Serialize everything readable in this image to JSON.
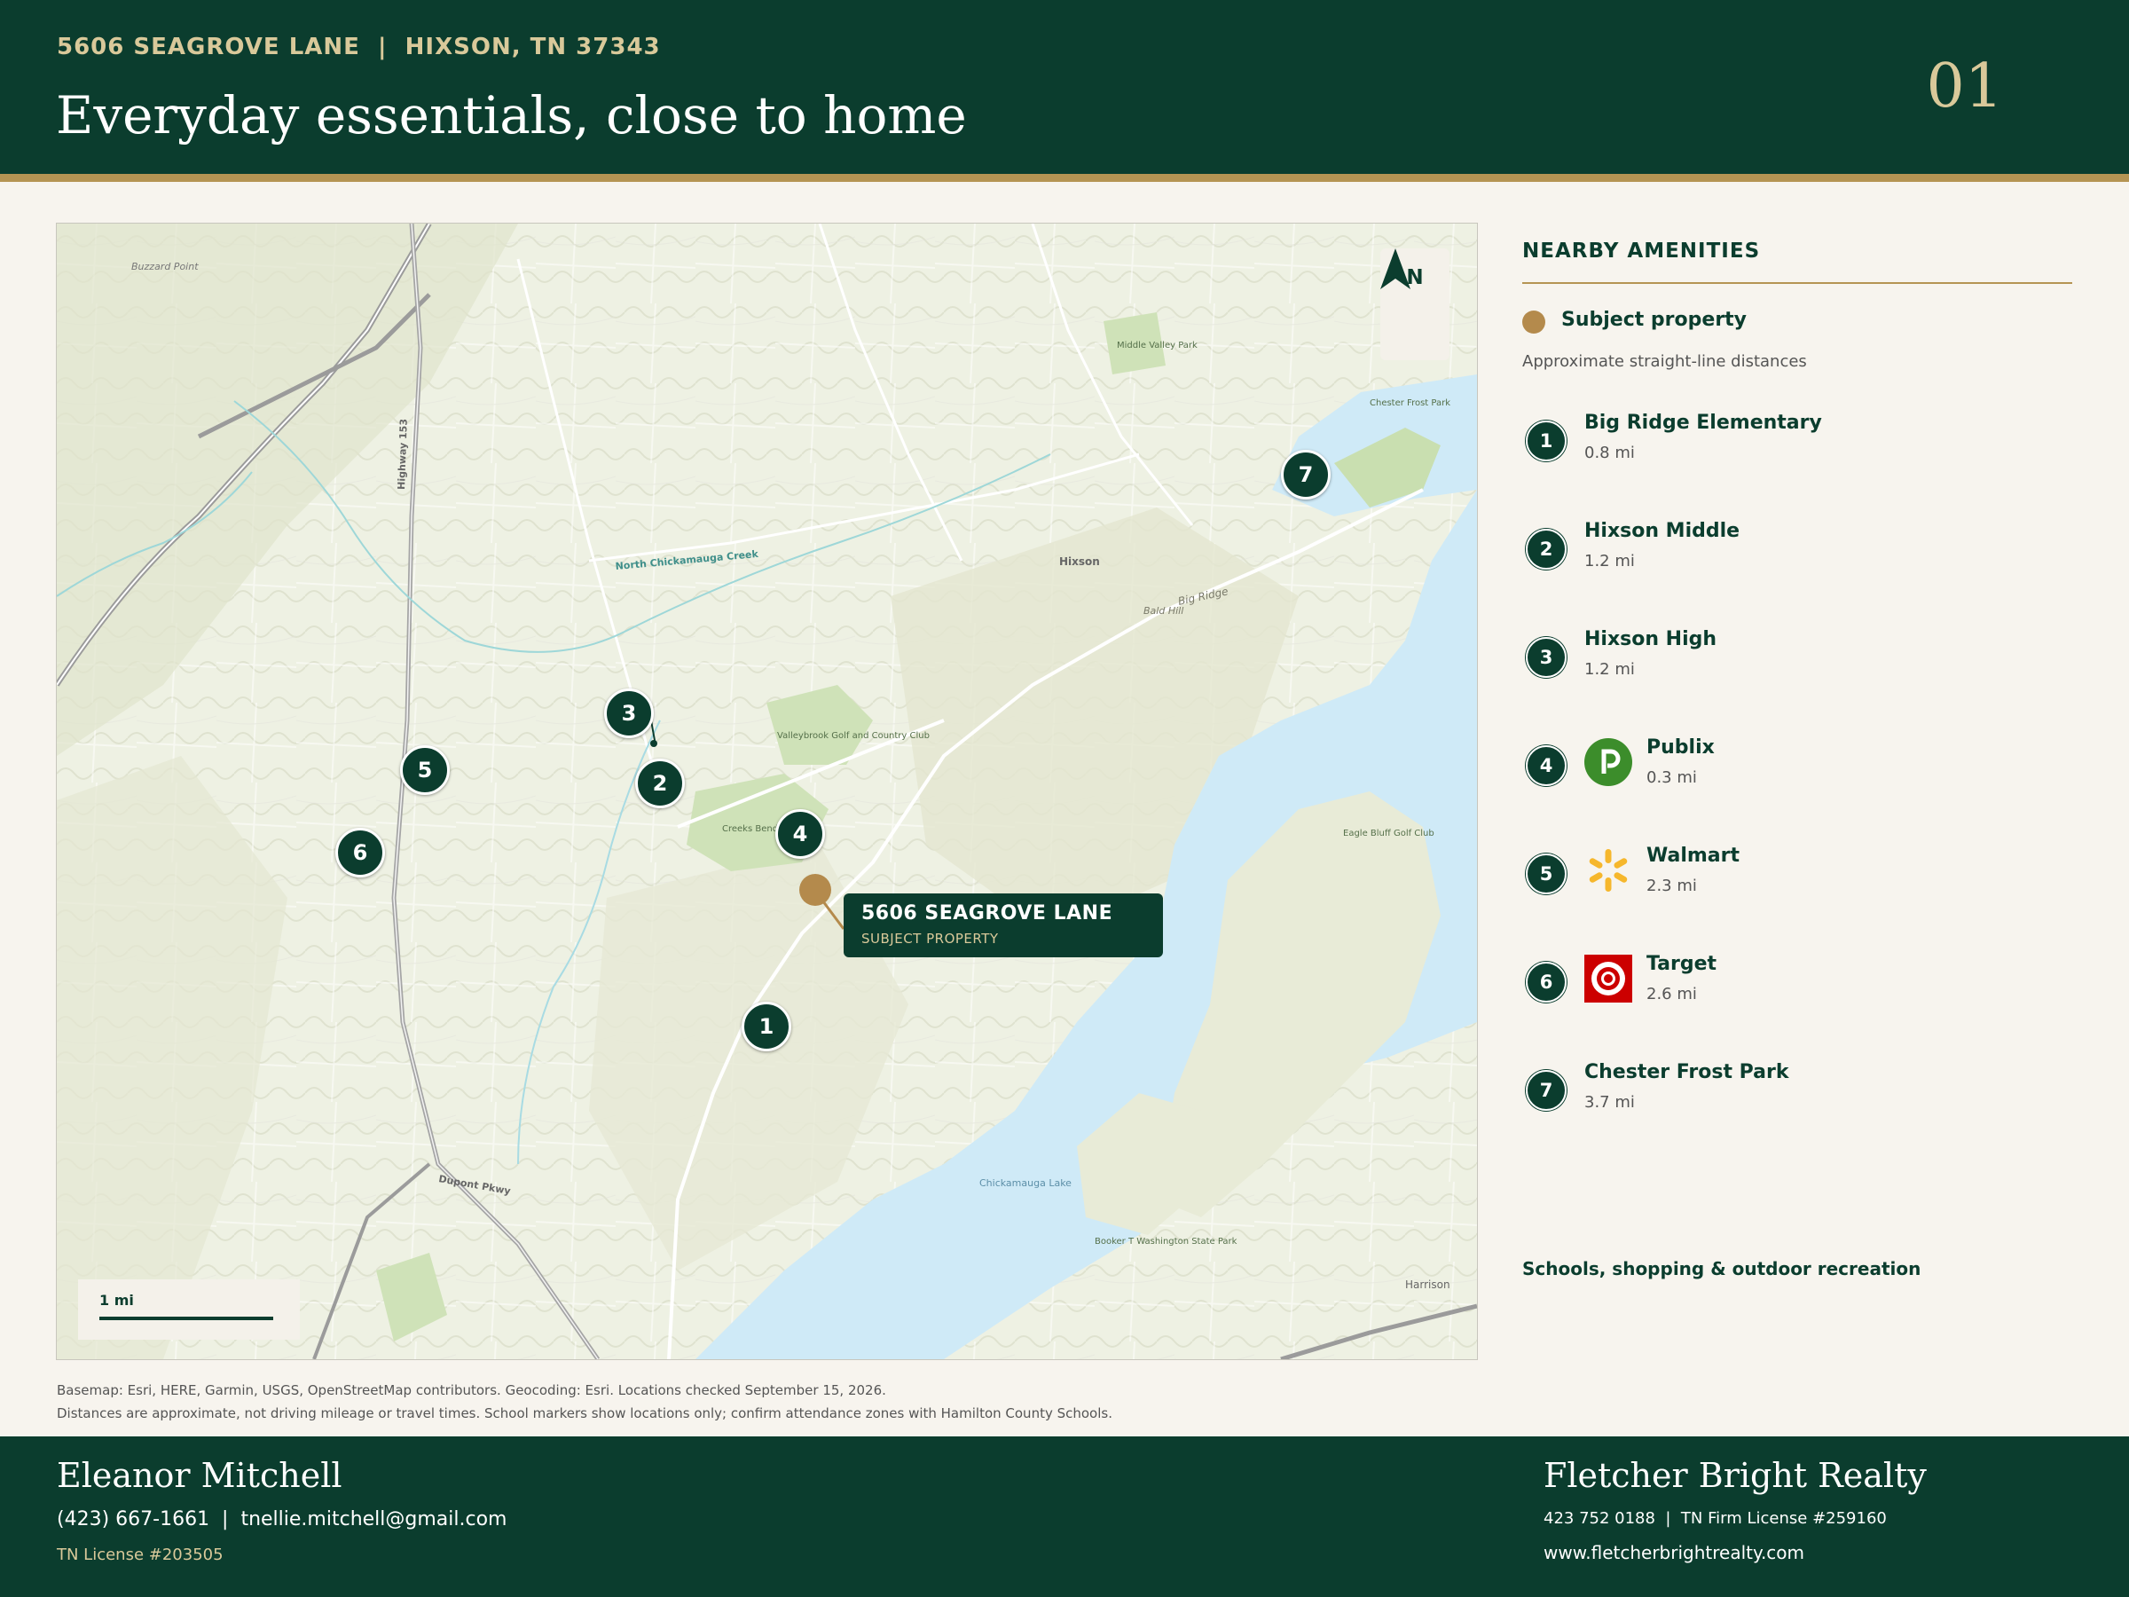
{
  "header": {
    "address": "5606 SEAGROVE LANE  |  HIXSON, TN 37343",
    "title": "Everyday essentials, close to home",
    "page_number": "01"
  },
  "map": {
    "north_label": "N",
    "scale_label": "1 mi",
    "subject": {
      "title": "5606 SEAGROVE LANE",
      "subtitle": "SUBJECT PROPERTY"
    },
    "markers": [
      "1",
      "2",
      "3",
      "4",
      "5",
      "6",
      "7"
    ],
    "basemap_labels": {
      "hixson": "Hixson",
      "big_ridge": "Big Ridge",
      "lake": "Chickamauga Lake",
      "harrison": "Harrison",
      "creek": "North Chickamauga Creek",
      "golf": "Creeks Bend Golf Club",
      "valleybrook": "Valleybrook Golf and Country Club",
      "chester_frost": "Chester Frost Park",
      "buzzard": "Buzzard Point",
      "bald_hill": "Bald Hill",
      "dupont": "Dupont Pkwy",
      "hwy153": "Highway 153",
      "eagle_bluff": "Eagle Bluff Golf Club",
      "booker": "Booker T Washington State Park",
      "middle_valley": "Middle Valley Park"
    }
  },
  "sidebar": {
    "heading": "NEARBY AMENITIES",
    "legend_label": "Subject property",
    "note": "Approximate straight-line distances",
    "items": [
      {
        "num": "1",
        "name": "Big Ridge Elementary",
        "distance": "0.8 mi",
        "logo": ""
      },
      {
        "num": "2",
        "name": "Hixson Middle",
        "distance": "1.2 mi",
        "logo": ""
      },
      {
        "num": "3",
        "name": "Hixson High",
        "distance": "1.2 mi",
        "logo": ""
      },
      {
        "num": "4",
        "name": "Publix",
        "distance": "0.3 mi",
        "logo": "publix-logo"
      },
      {
        "num": "5",
        "name": "Walmart",
        "distance": "2.3 mi",
        "logo": "walmart-spark-logo"
      },
      {
        "num": "6",
        "name": "Target",
        "distance": "2.6 mi",
        "logo": "target-logo"
      },
      {
        "num": "7",
        "name": "Chester Frost Park",
        "distance": "3.7 mi",
        "logo": ""
      }
    ],
    "tagline": "Schools, shopping & outdoor recreation"
  },
  "credits": {
    "line1": "Basemap: Esri, HERE, Garmin, USGS, OpenStreetMap contributors. Geocoding: Esri. Locations checked September 15, 2026.",
    "line2": "Distances are approximate, not driving mileage or travel times. School markers show locations only; confirm attendance zones with Hamilton County Schools."
  },
  "footer": {
    "agent_name": "Eleanor Mitchell",
    "agent_contact": "(423) 667-1661  |  tnellie.mitchell@gmail.com",
    "agent_license": "TN License #203505",
    "brokerage_name": "Fletcher Bright Realty",
    "brokerage_contact": "423 752 0188  |  TN Firm License #259160",
    "brokerage_web": "www.fletcherbrightrealty.com"
  },
  "colors": {
    "brand_green": "#0b3d2e",
    "gold": "#b59453",
    "subject_marker": "#b48a4c",
    "water": "#cfeaf7"
  }
}
